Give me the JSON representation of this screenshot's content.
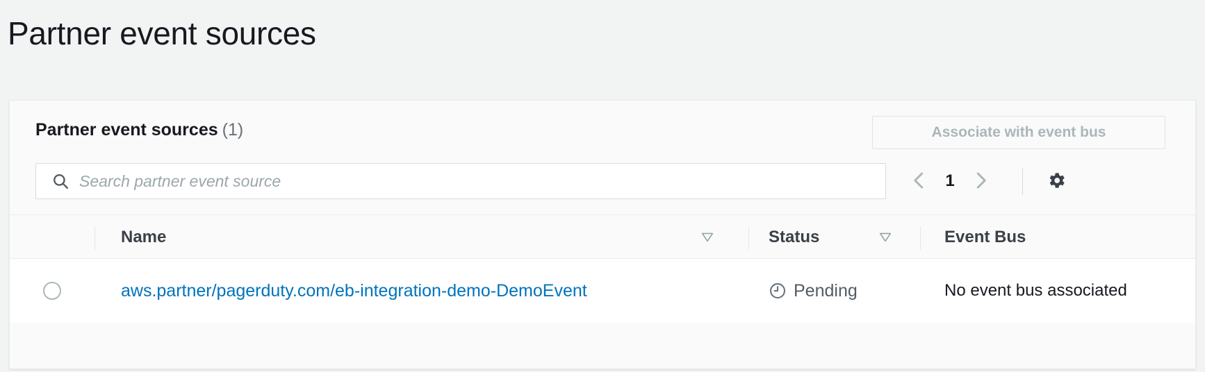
{
  "page": {
    "title": "Partner event sources"
  },
  "card": {
    "header": {
      "title": "Partner event sources",
      "count": "(1)",
      "associate_button_label": "Associate with event bus"
    },
    "tools": {
      "search_placeholder": "Search partner event source",
      "search_value": "",
      "search_icon": "search-icon",
      "pagination": {
        "previous_icon": "chevron-left-icon",
        "current_page": "1",
        "next_icon": "chevron-right-icon"
      },
      "preferences_icon": "gear-icon"
    },
    "table": {
      "columns": [
        {
          "label": "Name",
          "sortable": true,
          "sort_icon": "sort-triangle-icon"
        },
        {
          "label": "Status",
          "sortable": true,
          "sort_icon": "sort-triangle-icon"
        },
        {
          "label": "Event Bus",
          "sortable": false
        }
      ],
      "rows": [
        {
          "select_icon": "radio-unselected-icon",
          "name": "aws.partner/pagerduty.com/eb-integration-demo-DemoEvent",
          "status": "Pending",
          "status_icon": "clock-pending-icon",
          "event_bus": "No event bus associated"
        }
      ]
    }
  },
  "colors": {
    "link": "#0073bb",
    "page_background": "#f2f3f3",
    "card_background": "#fafafa",
    "row_background": "#ffffff",
    "disabled_text": "#aab7b8",
    "muted_text": "#687078"
  }
}
